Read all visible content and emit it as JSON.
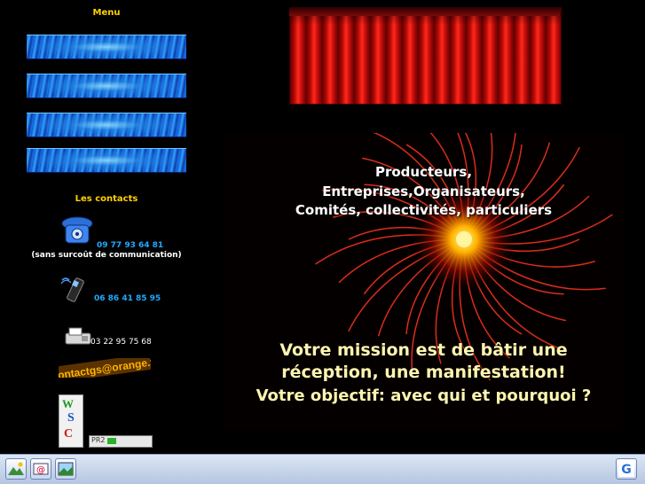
{
  "sidebar": {
    "menu_title": "Menu",
    "menu_items": [
      "",
      "",
      "",
      ""
    ],
    "contacts_title": "Les contacts",
    "contacts": {
      "landline": "09 77 93 64 81",
      "landline_note": "(sans surcoût de communication)",
      "mobile": "06 86 41 85 95",
      "fax": "03 22 95 75 68",
      "email_banner": "contactgs@orange.fr",
      "logo_letters": [
        "W",
        "S",
        "C"
      ]
    },
    "pagerank": {
      "label": "PR2",
      "value": 0.2
    }
  },
  "poster": {
    "line1": "Producteurs,",
    "line2": "Entreprises,Organisateurs,",
    "line3": "Comités, collectivités, particuliers",
    "mission1": "Votre mission est de bâtir une",
    "mission2": "réception, une manifestation!",
    "objective": "Votre objectif: avec qui et pourquoi ?"
  },
  "colors": {
    "accent_yellow": "#ffd200",
    "phone_blue": "#22aaff",
    "curtain_red": "#c20c0c"
  },
  "taskbar": {
    "icons": [
      "mountain-image-icon",
      "email-icon",
      "picture-icon"
    ],
    "right_icon": "google-icon"
  }
}
